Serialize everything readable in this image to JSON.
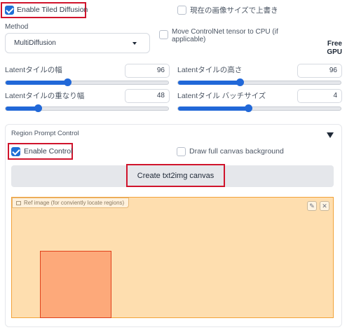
{
  "top": {
    "enable_tiled_diffusion": "Enable Tiled Diffusion",
    "overwrite_image_size": "現在の画像サイズで上書き",
    "move_controlnet_label": "Move ControlNet tensor to CPU (if applicable)",
    "free_gpu": "Free GPU"
  },
  "method": {
    "label": "Method",
    "value": "MultiDiffusion"
  },
  "sliders": {
    "latent_width": {
      "label": "Latentタイルの幅",
      "value": "96",
      "fraction": 0.38
    },
    "latent_height": {
      "label": "Latentタイルの高さ",
      "value": "96",
      "fraction": 0.38
    },
    "latent_overlap": {
      "label": "Latentタイルの重なり幅",
      "value": "48",
      "fraction": 0.2
    },
    "latent_batch": {
      "label": "Latentタイル バッチサイズ",
      "value": "4",
      "fraction": 0.43
    }
  },
  "region": {
    "title": "Region Prompt Control",
    "enable_control": "Enable Control",
    "draw_full_canvas": "Draw full canvas background",
    "create_canvas_button": "Create txt2img canvas",
    "ref_image_label": "Ref image (for conviently locate regions)"
  },
  "colors": {
    "accent": "#2168d8",
    "highlight": "#d0142c",
    "ref_bg": "#fedeaf",
    "region_fill": "#fda97a"
  }
}
